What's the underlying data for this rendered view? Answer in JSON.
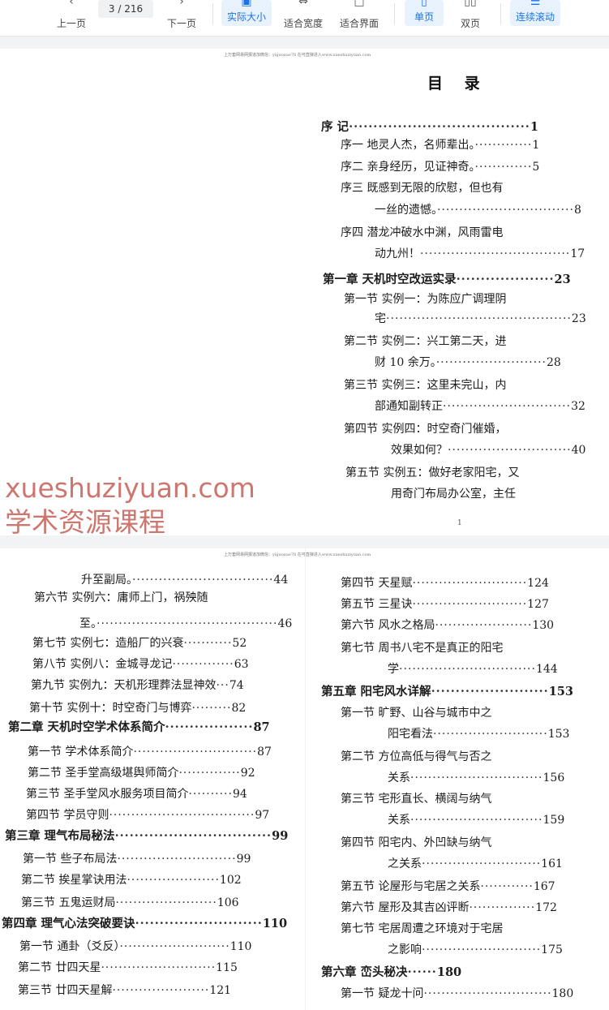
{
  "toolbar": {
    "prev_label": "上一页",
    "next_label": "下一页",
    "current_page": "3",
    "page_sep": "/",
    "total_pages": "216",
    "actual_size": "实际大小",
    "fit_width": "适合宽度",
    "fit_page": "适合界面",
    "single_page": "单页",
    "double_page": "双页",
    "continuous": "连续滚动",
    "icons": [
      "chevron-left-icon",
      "chevron-right-icon",
      "actual-size-icon",
      "fit-width-icon",
      "fit-page-icon",
      "single-page-icon",
      "double-page-icon",
      "continuous-scroll-icon"
    ]
  },
  "page1": {
    "header": "上万套网易网报道加微信：yiguoxue78  在可直接进入www.xueshuziyuan.com",
    "title": "目 录",
    "footer": "1",
    "lines": [
      {
        "label": "序 记",
        "dots": "·····································",
        "page": "1",
        "bold": true
      },
      {
        "label": "序一  地灵人杰，名师辈出。",
        "dots": "·············",
        "page": "1"
      },
      {
        "label": "序二  亲身经历，见证神奇。",
        "dots": "·············",
        "page": "5"
      },
      {
        "label": "序三  既感到无限的欣慰，但也有",
        "dots": "",
        "page": ""
      },
      {
        "label": "一丝的遗憾。",
        "dots": "·······························",
        "page": "8"
      },
      {
        "label": "序四  潜龙冲破水中渊，风雨雷电",
        "dots": "",
        "page": ""
      },
      {
        "label": "动九州！",
        "dots": "··································",
        "page": "17"
      },
      {
        "label": "第一章    天机时空改运实录",
        "dots": "····················",
        "page": "23",
        "bold": true
      },
      {
        "label": "第一节  实例一：为陈应广调理阴",
        "dots": "",
        "page": ""
      },
      {
        "label": "宅",
        "dots": "··········································",
        "page": "23"
      },
      {
        "label": "第二节  实例二：兴工第二天，进",
        "dots": "",
        "page": ""
      },
      {
        "label": "财 10 余万。",
        "dots": "·························",
        "page": "28"
      },
      {
        "label": "第三节  实例三：这里未完山，内",
        "dots": "",
        "page": ""
      },
      {
        "label": "部通知副转正",
        "dots": "·····························",
        "page": "32"
      },
      {
        "label": "第四节  实例四：时空奇门催婚，",
        "dots": "",
        "page": ""
      },
      {
        "label": "效果如何？",
        "dots": "····························",
        "page": "40"
      },
      {
        "label": "第五节  实例五：做好老家阳宅，又",
        "dots": "",
        "page": ""
      },
      {
        "label": "用奇门布局办公室，主任",
        "dots": "",
        "page": ""
      }
    ]
  },
  "page2": {
    "header": "上万套网易网报道加微信：yiguoxue78  在可直接进入www.xueshuziyuan.com",
    "left": [
      {
        "label": "升至副局。",
        "dots": "································",
        "page": "44"
      },
      {
        "label": "第六节  实例六：庸师上门，祸殃随",
        "dots": "",
        "page": ""
      },
      {
        "label": "至。",
        "dots": "·········································",
        "page": "46"
      },
      {
        "label": "第七节  实例七：造船厂的兴衰",
        "dots": "···········",
        "page": "52"
      },
      {
        "label": "第八节  实例八：金城寻龙记",
        "dots": "··············",
        "page": "63"
      },
      {
        "label": "第九节  实例九：天机形理葬法显神效",
        "dots": "···",
        "page": "74"
      },
      {
        "label": "第十节  实例十：时空奇门与博弈",
        "dots": "·········",
        "page": "82"
      },
      {
        "label": "第二章    天机时空学术体系简介",
        "dots": "··················",
        "page": "87",
        "bold": true
      },
      {
        "label": "第一节  学术体系简介",
        "dots": "····························",
        "page": "87"
      },
      {
        "label": "第二节  圣手堂高级堪舆师简介",
        "dots": "··············",
        "page": "92"
      },
      {
        "label": "第三节  圣手堂风水服务项目简介",
        "dots": "··········",
        "page": "94"
      },
      {
        "label": "第四节  学员守则",
        "dots": "·································",
        "page": "97"
      },
      {
        "label": "第三章    理气布局秘法",
        "dots": "································",
        "page": "99",
        "bold": true
      },
      {
        "label": "第一节  些子布局法",
        "dots": "···························",
        "page": "99"
      },
      {
        "label": "第二节  挨星掌诀用法",
        "dots": "·····················",
        "page": "102"
      },
      {
        "label": "第三节  五鬼运财局",
        "dots": "·······················",
        "page": "106"
      },
      {
        "label": "第四章  理气心法突破要诀",
        "dots": "··························",
        "page": "110",
        "bold": true
      },
      {
        "label": "第一节  通卦（爻反）",
        "dots": "·························",
        "page": "110"
      },
      {
        "label": "第二节  廿四天星",
        "dots": "··························",
        "page": "115"
      },
      {
        "label": "第三节  廿四天星解",
        "dots": "······················",
        "page": "121"
      }
    ],
    "right": [
      {
        "label": "第四节  天星赋",
        "dots": "··························",
        "page": "124"
      },
      {
        "label": "第五节  三星诀",
        "dots": "··························",
        "page": "127"
      },
      {
        "label": "第六节  风水之格局",
        "dots": "······················",
        "page": "130"
      },
      {
        "label": "第七节  周书八宅不是真正的阳宅",
        "dots": "",
        "page": ""
      },
      {
        "label": "学",
        "dots": "·······························",
        "page": "144"
      },
      {
        "label": "第五章    阳宅风水详解",
        "dots": "························",
        "page": "153",
        "bold": true
      },
      {
        "label": "第一节  旷野、山谷与城市中之",
        "dots": "",
        "page": ""
      },
      {
        "label": "阳宅看法",
        "dots": "··························",
        "page": "153"
      },
      {
        "label": "第二节  方位高低与得气与否之",
        "dots": "",
        "page": ""
      },
      {
        "label": "关系",
        "dots": "······························",
        "page": "156"
      },
      {
        "label": "第三节  宅形直长、横阔与纳气",
        "dots": "",
        "page": ""
      },
      {
        "label": "关系",
        "dots": "······························",
        "page": "159"
      },
      {
        "label": "第四节  阳宅内、外凹缺与纳气",
        "dots": "",
        "page": ""
      },
      {
        "label": "之关系",
        "dots": "···························",
        "page": "161"
      },
      {
        "label": "第五节  论屋形与宅居之关系",
        "dots": "············",
        "page": "167"
      },
      {
        "label": "第六节  屋形及其吉凶评断",
        "dots": "···············",
        "page": "172"
      },
      {
        "label": "第七节  宅居周遭之环境对于宅居",
        "dots": "",
        "page": ""
      },
      {
        "label": "之影响",
        "dots": "···························",
        "page": "175"
      },
      {
        "label": "第六章    峦头秘决",
        "dots": "······",
        "page": "180",
        "bold": true
      },
      {
        "label": "第一节  疑龙十问",
        "dots": "·····························",
        "page": "180"
      }
    ]
  },
  "watermark": {
    "line1": "xueshuziyuan.com",
    "line2": "学术资源课程"
  }
}
